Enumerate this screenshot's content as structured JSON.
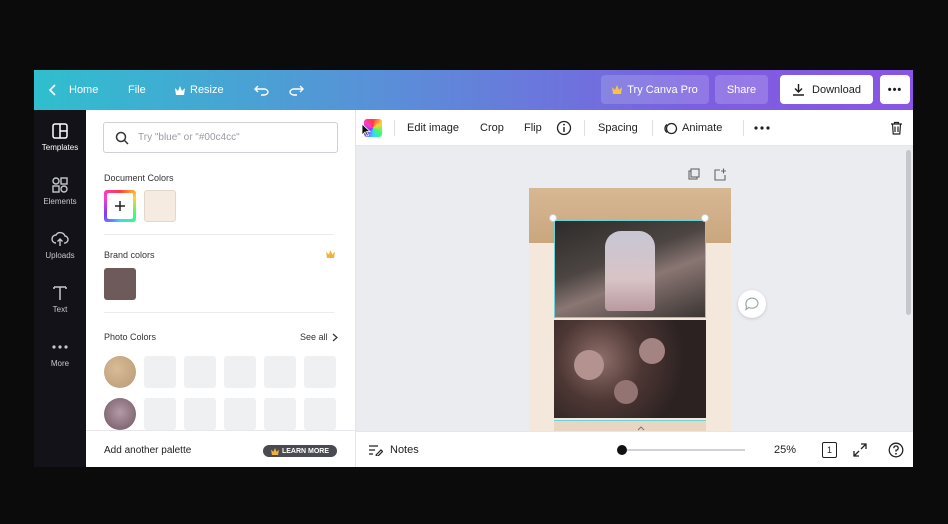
{
  "topbar": {
    "home": "Home",
    "file": "File",
    "resize": "Resize",
    "try_pro": "Try Canva Pro",
    "share": "Share",
    "download": "Download",
    "more": "•••"
  },
  "rail": {
    "items": [
      {
        "label": "Templates",
        "icon": "templates-icon"
      },
      {
        "label": "Elements",
        "icon": "elements-icon"
      },
      {
        "label": "Uploads",
        "icon": "uploads-icon"
      },
      {
        "label": "Text",
        "icon": "text-icon"
      },
      {
        "label": "More",
        "icon": "more-icon"
      }
    ]
  },
  "panel": {
    "search_placeholder": "Try \"blue\" or \"#00c4cc\"",
    "document_colors_title": "Document Colors",
    "document_colors": [
      "#f6ebe0"
    ],
    "brand_colors_title": "Brand colors",
    "brand_colors": [
      "#6e5a5b"
    ],
    "photo_colors_title": "Photo Colors",
    "see_all": "See all",
    "add_palette": "Add another palette",
    "learn_more": "LEARN MORE"
  },
  "editor_toolbar": {
    "edit_image": "Edit image",
    "crop": "Crop",
    "flip": "Flip",
    "spacing": "Spacing",
    "animate": "Animate"
  },
  "bottombar": {
    "notes": "Notes",
    "zoom": "25%",
    "page_number": "1"
  },
  "colors": {
    "rail_bg": "#121218",
    "accent_purple": "#7d5be0",
    "selection": "#69d3d8"
  }
}
